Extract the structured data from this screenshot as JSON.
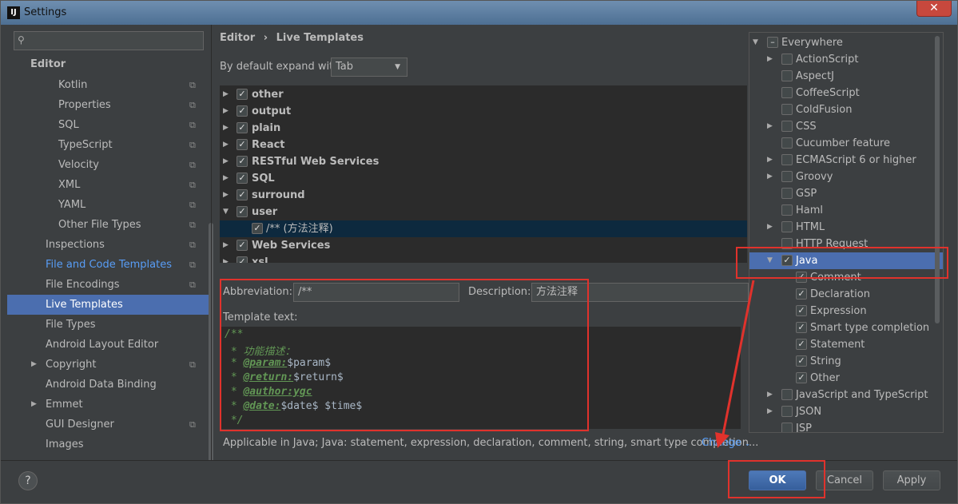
{
  "window": {
    "title": "Settings",
    "app_icon": "IJ",
    "close_glyph": "✕"
  },
  "search": {
    "placeholder": ""
  },
  "sidebar": {
    "section": "Editor",
    "items": [
      {
        "label": "Kotlin",
        "copy": true,
        "indent": 64
      },
      {
        "label": "Properties",
        "copy": true,
        "indent": 64
      },
      {
        "label": "SQL",
        "copy": true,
        "indent": 64
      },
      {
        "label": "TypeScript",
        "copy": true,
        "indent": 64
      },
      {
        "label": "Velocity",
        "copy": true,
        "indent": 64
      },
      {
        "label": "XML",
        "copy": true,
        "indent": 64
      },
      {
        "label": "YAML",
        "copy": true,
        "indent": 64
      },
      {
        "label": "Other File Types",
        "copy": true,
        "indent": 64
      },
      {
        "label": "Inspections",
        "copy": true,
        "indent": 48
      },
      {
        "label": "File and Code Templates",
        "copy": true,
        "indent": 48,
        "style": "link"
      },
      {
        "label": "File Encodings",
        "copy": true,
        "indent": 48
      },
      {
        "label": "Live Templates",
        "copy": false,
        "indent": 48,
        "style": "selected"
      },
      {
        "label": "File Types",
        "copy": false,
        "indent": 48
      },
      {
        "label": "Android Layout Editor",
        "copy": false,
        "indent": 48
      },
      {
        "label": "Copyright",
        "copy": true,
        "indent": 48,
        "arrow": true
      },
      {
        "label": "Android Data Binding",
        "copy": false,
        "indent": 48
      },
      {
        "label": "Emmet",
        "copy": false,
        "indent": 48,
        "arrow": true
      },
      {
        "label": "GUI Designer",
        "copy": true,
        "indent": 48
      },
      {
        "label": "Images",
        "copy": false,
        "indent": 48
      }
    ]
  },
  "breadcrumb": {
    "part1": "Editor",
    "sep": "›",
    "part2": "Live Templates"
  },
  "expand": {
    "label": "By default expand with",
    "value": "Tab"
  },
  "template_groups": [
    {
      "name": "other",
      "expanded": false
    },
    {
      "name": "output",
      "expanded": false
    },
    {
      "name": "plain",
      "expanded": false
    },
    {
      "name": "React",
      "expanded": false
    },
    {
      "name": "RESTful Web Services",
      "expanded": false
    },
    {
      "name": "SQL",
      "expanded": false
    },
    {
      "name": "surround",
      "expanded": false
    },
    {
      "name": "user",
      "expanded": true
    },
    {
      "name": "/** (方法注释)",
      "child": true,
      "selected": true
    },
    {
      "name": "Web Services",
      "expanded": false
    },
    {
      "name": "xsl",
      "expanded": false
    }
  ],
  "form": {
    "abbr_label": "Abbreviation:",
    "abbr_value": "/**",
    "desc_label": "Description:",
    "desc_value": "方法注释",
    "template_label": "Template text:"
  },
  "template_text": {
    "l1": "/**",
    "l2": " * 功能描述：",
    "l3_pre": " * ",
    "l3_tag": "@param:",
    "l3_var": "$param$",
    "l4_pre": " * ",
    "l4_tag": "@return:",
    "l4_var": "$return$",
    "l5_pre": " * ",
    "l5_tag": "@author:ygc",
    "l6_pre": " * ",
    "l6_tag": "@date:",
    "l6_var": "$date$ $time$",
    "l7": " */"
  },
  "applicable": {
    "text": "Applicable in Java; Java: statement, expression, declaration, comment, string, smart type completion...",
    "change_label": "Change"
  },
  "context_popup": {
    "items": [
      {
        "label": "Everywhere",
        "level": 0,
        "arrow": "down",
        "checkbox": "partial"
      },
      {
        "label": "ActionScript",
        "level": 1,
        "arrow": "right",
        "checkbox": "off"
      },
      {
        "label": "AspectJ",
        "level": 1,
        "checkbox": "off"
      },
      {
        "label": "CoffeeScript",
        "level": 1,
        "checkbox": "off"
      },
      {
        "label": "ColdFusion",
        "level": 1,
        "checkbox": "off"
      },
      {
        "label": "CSS",
        "level": 1,
        "arrow": "right",
        "checkbox": "off"
      },
      {
        "label": "Cucumber feature",
        "level": 1,
        "checkbox": "off"
      },
      {
        "label": "ECMAScript 6 or higher",
        "level": 1,
        "arrow": "right",
        "checkbox": "off"
      },
      {
        "label": "Groovy",
        "level": 1,
        "arrow": "right",
        "checkbox": "off"
      },
      {
        "label": "GSP",
        "level": 1,
        "checkbox": "off"
      },
      {
        "label": "Haml",
        "level": 1,
        "checkbox": "off"
      },
      {
        "label": "HTML",
        "level": 1,
        "arrow": "right",
        "checkbox": "off"
      },
      {
        "label": "HTTP Request",
        "level": 1,
        "checkbox": "off"
      },
      {
        "label": "Java",
        "level": 1,
        "arrow": "down",
        "checkbox": "on",
        "selected": true
      },
      {
        "label": "Comment",
        "level": 2,
        "checkbox": "on"
      },
      {
        "label": "Declaration",
        "level": 2,
        "checkbox": "on"
      },
      {
        "label": "Expression",
        "level": 2,
        "checkbox": "on"
      },
      {
        "label": "Smart type completion",
        "level": 2,
        "checkbox": "on"
      },
      {
        "label": "Statement",
        "level": 2,
        "checkbox": "on"
      },
      {
        "label": "String",
        "level": 2,
        "checkbox": "on"
      },
      {
        "label": "Other",
        "level": 2,
        "checkbox": "on"
      },
      {
        "label": "JavaScript and TypeScript",
        "level": 1,
        "arrow": "right",
        "checkbox": "off"
      },
      {
        "label": "JSON",
        "level": 1,
        "arrow": "right",
        "checkbox": "off"
      },
      {
        "label": "JSP",
        "level": 1,
        "checkbox": "off"
      }
    ]
  },
  "buttons": {
    "help": "?",
    "ok": "OK",
    "cancel": "Cancel",
    "apply": "Apply"
  },
  "colors": {
    "selection": "#4b6eaf",
    "annotation": "#e0322c",
    "link": "#589df6"
  }
}
